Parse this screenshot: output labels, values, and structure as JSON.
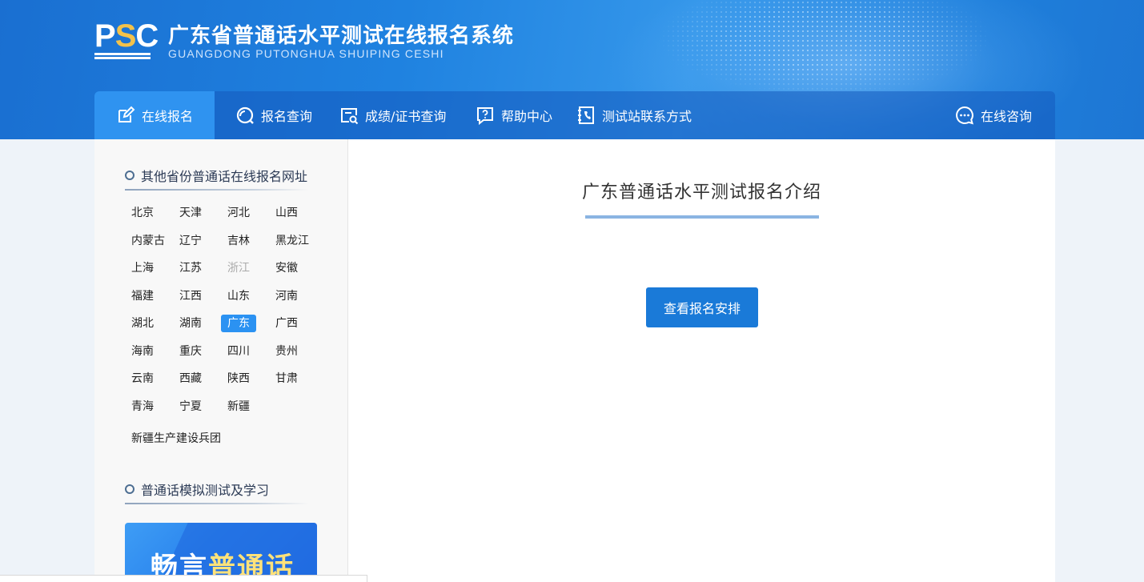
{
  "header": {
    "logo_text": "PSC",
    "title": "广东省普通话水平测试在线报名系统",
    "subtitle": "GUANGDONG PUTONGHUA SHUIPING CESHI"
  },
  "nav": {
    "items": [
      {
        "label": "在线报名",
        "icon": "edit-icon",
        "active": true
      },
      {
        "label": "报名查询",
        "icon": "search-circle-icon"
      },
      {
        "label": "成绩/证书查询",
        "icon": "certificate-search-icon"
      },
      {
        "label": "帮助中心",
        "icon": "help-icon"
      },
      {
        "label": "测试站联系方式",
        "icon": "phone-book-icon"
      }
    ],
    "consult": {
      "label": "在线咨询",
      "icon": "chat-icon"
    }
  },
  "sidebar": {
    "provinces_title": "其他省份普通话在线报名网址",
    "provinces": [
      "北京",
      "天津",
      "河北",
      "山西",
      "内蒙古",
      "辽宁",
      "吉林",
      "黑龙江",
      "上海",
      "江苏",
      "浙江",
      "安徽",
      "福建",
      "江西",
      "山东",
      "河南",
      "湖北",
      "湖南",
      "广东",
      "广西",
      "海南",
      "重庆",
      "四川",
      "贵州",
      "云南",
      "西藏",
      "陕西",
      "甘肃",
      "青海",
      "宁夏",
      "新疆"
    ],
    "extra_province": "新疆生产建设兵团",
    "selected": "广东",
    "disabled": "浙江",
    "study_title": "普通话模拟测试及学习",
    "promo_prefix": "畅言",
    "promo_highlight": "普通话"
  },
  "main": {
    "title": "广东普通话水平测试报名介绍",
    "button_label": "查看报名安排"
  },
  "colors": {
    "accent": "#1a7ad8",
    "nav_active": "#2f93f0",
    "header": "#1f82e0"
  }
}
